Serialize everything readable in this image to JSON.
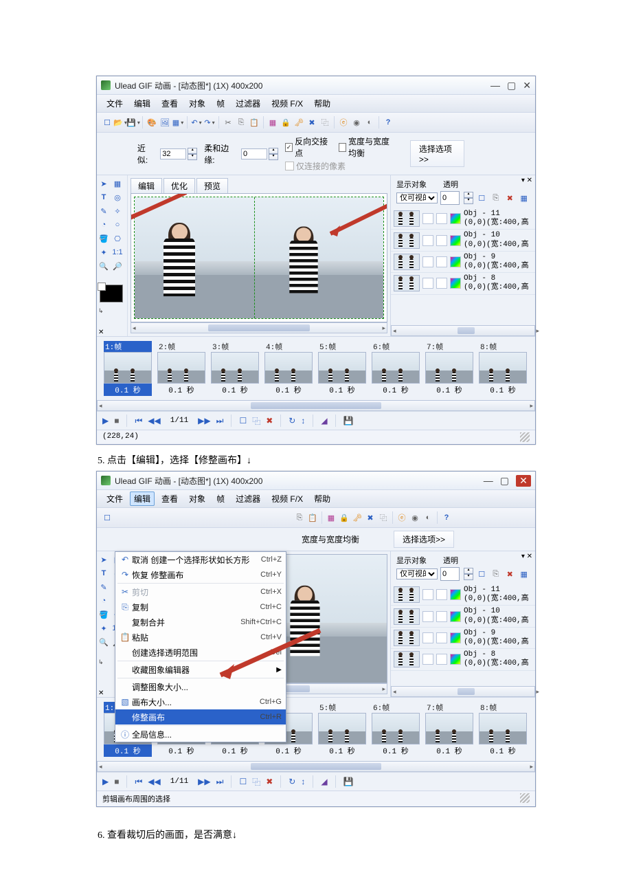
{
  "title": "Ulead GIF 动画 - [动态图*] (1X) 400x200",
  "menu": {
    "file": "文件",
    "edit": "编辑",
    "view": "查看",
    "obj": "对象",
    "frame": "帧",
    "filter": "过滤器",
    "vfx": "视频 F/X",
    "help": "帮助"
  },
  "opt": {
    "near": "近似:",
    "near_v": "32",
    "soft": "柔和边缘:",
    "soft_v": "0",
    "chk1": "反向交接点",
    "chk2": "宽度与宽度均衡",
    "chk3": "仅连接的像素",
    "selbtn": "选择选项>>"
  },
  "tabs": {
    "edit": "编辑",
    "opt": "优化",
    "prev": "预览"
  },
  "panel": {
    "show": "显示对象",
    "trans": "透明",
    "vis": "仅可视的",
    "trans_v": "0",
    "objs": [
      {
        "n": "Obj - 11",
        "d": "(0,0)(宽:400,高"
      },
      {
        "n": "Obj - 10",
        "d": "(0,0)(宽:400,高"
      },
      {
        "n": "Obj - 9",
        "d": "(0,0)(宽:400,高"
      },
      {
        "n": "Obj - 8",
        "d": "(0,0)(宽:400,高"
      }
    ]
  },
  "frames": [
    {
      "l": "1:帧",
      "d": "0.1 秒"
    },
    {
      "l": "2:帧",
      "d": "0.1 秒"
    },
    {
      "l": "3:帧",
      "d": "0.1 秒"
    },
    {
      "l": "4:帧",
      "d": "0.1 秒"
    },
    {
      "l": "5:帧",
      "d": "0.1 秒"
    },
    {
      "l": "6:帧",
      "d": "0.1 秒"
    },
    {
      "l": "7:帧",
      "d": "0.1 秒"
    },
    {
      "l": "8:帧",
      "d": "0.1 秒"
    }
  ],
  "play": {
    "counter": "1/11"
  },
  "status1": "(228,24)",
  "status2": "剪辑画布周围的选择",
  "step5": "5.  点击【编辑】，选择【修整画布】↓",
  "step6": "6.  查看裁切后的画面，是否满意↓",
  "dd": [
    {
      "ico": "↶",
      "lbl": "取消 创建一个选择形状如长方形",
      "sc": "Ctrl+Z"
    },
    {
      "ico": "↷",
      "lbl": "恢复 修整画布",
      "sc": "Ctrl+Y"
    },
    {
      "sep": true
    },
    {
      "ico": "✂",
      "lbl": "剪切",
      "sc": "Ctrl+X",
      "dis": true
    },
    {
      "ico": "⎘",
      "lbl": "复制",
      "sc": "Ctrl+C"
    },
    {
      "ico": "",
      "lbl": "复制合并",
      "sc": "Shift+Ctrl+C"
    },
    {
      "ico": "📋",
      "lbl": "粘贴",
      "sc": "Ctrl+V"
    },
    {
      "ico": "",
      "lbl": "创建选择透明范围",
      "sc": "Del"
    },
    {
      "sep": true
    },
    {
      "ico": "",
      "lbl": "收藏图象编辑器",
      "sub": "▶"
    },
    {
      "sep": true
    },
    {
      "ico": "",
      "lbl": "调整图象大小..."
    },
    {
      "ico": "▧",
      "lbl": "画布大小...",
      "sc": "Ctrl+G"
    },
    {
      "ico": "",
      "lbl": "修整画布",
      "sc": "Ctrl+R",
      "hl": true
    },
    {
      "sep": true
    },
    {
      "ico": "ⓘ",
      "lbl": "全局信息..."
    }
  ]
}
